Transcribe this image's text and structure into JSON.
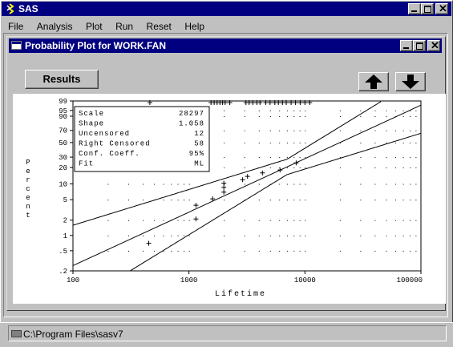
{
  "app": {
    "title": "SAS"
  },
  "menu": [
    "File",
    "Analysis",
    "Plot",
    "Run",
    "Reset",
    "Help"
  ],
  "inner_window": {
    "title": "Probability Plot for WORK.FAN"
  },
  "results_button": "Results",
  "status_path": "C:\\Program Files\\sasv7",
  "chart_data": {
    "type": "scatter",
    "xlabel": "Lifetime",
    "ylabel": "Percent",
    "x_scale": "log",
    "xlim": [
      100,
      100000
    ],
    "x_ticks": [
      "100",
      "1000",
      "10000",
      "100000"
    ],
    "y_scale": "weibull-probability",
    "ylim": [
      0.2,
      99
    ],
    "y_ticks": [
      "99",
      "95",
      "90",
      "70",
      "50",
      "30",
      "20",
      "10",
      "5",
      "2",
      "1",
      ".5",
      ".2"
    ],
    "info_box": [
      {
        "label": "Scale",
        "value": "28297"
      },
      {
        "label": "Shape",
        "value": "1.058"
      },
      {
        "label": "Uncensored",
        "value": "12"
      },
      {
        "label": "Right Censored",
        "value": "58"
      },
      {
        "label": "Conf. Coeff.",
        "value": "95%"
      },
      {
        "label": "Fit",
        "value": "ML"
      }
    ],
    "points": [
      [
        450,
        0.7
      ],
      [
        1150,
        2.1
      ],
      [
        1150,
        3.9
      ],
      [
        1600,
        5.2
      ],
      [
        2000,
        7.0
      ],
      [
        2000,
        8.6
      ],
      [
        2000,
        10.3
      ],
      [
        2900,
        12.0
      ],
      [
        3200,
        13.8
      ],
      [
        4300,
        16.0
      ],
      [
        6100,
        18.0
      ],
      [
        8400,
        24.0
      ]
    ],
    "censored_marks": [
      460,
      1550,
      1650,
      1750,
      1850,
      1950,
      2050,
      2250,
      3100,
      3300,
      3550,
      3850,
      4100,
      4600,
      5000,
      5500,
      5900,
      6400,
      6900,
      7600,
      8300,
      9100,
      10000,
      11000
    ]
  }
}
